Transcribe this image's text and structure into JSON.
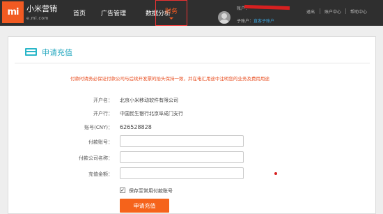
{
  "brand": {
    "logo_text": "mi",
    "name": "小米营销",
    "domain": "e.mi.com"
  },
  "nav": {
    "home": "首页",
    "ads": "广告管理",
    "analytics": "数据分析",
    "finance": "财务"
  },
  "user": {
    "account_label": "账户：",
    "sub_label": "子账户：",
    "sub_value": "直客子账户"
  },
  "top_links": {
    "logout": "退出",
    "account_center": "账户中心",
    "help_center": "帮助中心"
  },
  "page": {
    "title": "申请充值",
    "notice": "付款时请务必保证付款公司与后续开发票的抬头保持一致，并在电汇用途中注明您的业务及费用用途"
  },
  "form": {
    "account_name_label": "开户名：",
    "account_name_value": "北京小米移动软件有限公司",
    "bank_label": "开户行：",
    "bank_value": "中国民生银行北京阜成门支行",
    "account_no_label": "账号(CNY)：",
    "account_no_value": "626528828",
    "payer_account_label": "付款账号：",
    "payer_company_label": "付款公司名称：",
    "amount_label": "充值金额：",
    "save_checkbox_label": "保存至常用付款账号",
    "save_checked": true,
    "submit_label": "申请充值"
  },
  "colors": {
    "topbar": "#2f2f2f",
    "brand_orange": "#f15a22",
    "title_teal": "#29a9c0",
    "notice_red": "#e84c1e",
    "button_orange": "#f5631b"
  }
}
